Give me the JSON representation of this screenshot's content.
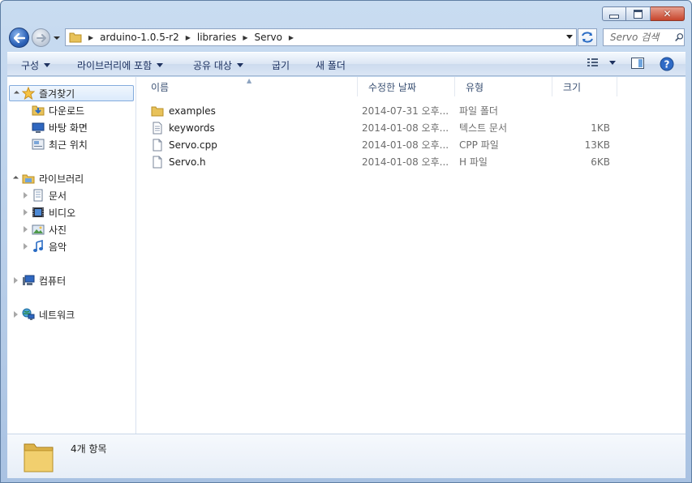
{
  "window": {
    "caption_buttons": {
      "minimize": "",
      "maximize": "",
      "close": "✕"
    }
  },
  "address_bar": {
    "breadcrumbs": [
      "arduino-1.0.5-r2",
      "libraries",
      "Servo"
    ]
  },
  "search": {
    "placeholder": "Servo 검색"
  },
  "toolbar": {
    "organize": "구성",
    "include_in_library": "라이브러리에 포함",
    "share_with": "공유 대상",
    "burn": "굽기",
    "new_folder": "새 폴더"
  },
  "nav": {
    "favorites": "즐겨찾기",
    "downloads": "다운로드",
    "desktop": "바탕 화면",
    "recent": "최근 위치",
    "libraries": "라이브러리",
    "documents": "문서",
    "videos": "비디오",
    "pictures": "사진",
    "music": "음악",
    "computer": "컴퓨터",
    "network": "네트워크"
  },
  "columns": {
    "name": "이름",
    "date": "수정한 날짜",
    "type": "유형",
    "size": "크기"
  },
  "files": [
    {
      "name": "examples",
      "date": "2014-07-31 오후...",
      "type": "파일 폴더",
      "size": "",
      "icon": "folder-icon"
    },
    {
      "name": "keywords",
      "date": "2014-01-08 오후...",
      "type": "텍스트 문서",
      "size": "1KB",
      "icon": "text-file-icon"
    },
    {
      "name": "Servo.cpp",
      "date": "2014-01-08 오후...",
      "type": "CPP 파일",
      "size": "13KB",
      "icon": "file-icon"
    },
    {
      "name": "Servo.h",
      "date": "2014-01-08 오후...",
      "type": "H 파일",
      "size": "6KB",
      "icon": "file-icon"
    }
  ],
  "details": {
    "count": "4개 항목"
  },
  "colors": {
    "accent": "#2d63b8",
    "selection": "#dbeafb",
    "close": "#c7452c"
  }
}
